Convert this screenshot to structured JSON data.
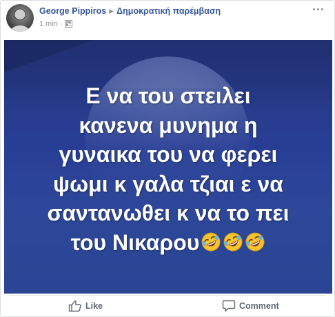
{
  "post": {
    "author": "George Pippiros",
    "group": "Δημοκρατική παρέμβαση",
    "time": "1 min",
    "caption_lines": [
      "Ε να του στειλει",
      "κανενα μυνημα η",
      "γυναικα του να φερει",
      "ψωμι κ γαλα τζιαι ε να",
      "σαντανωθει κ να το πει",
      "του Νικαρου"
    ],
    "caption_emoji": "rolling-on-floor-laughing x3"
  },
  "actions": {
    "like_label": "Like",
    "comment_label": "Comment"
  },
  "colors": {
    "link": "#365899",
    "meta": "#90949c",
    "action": "#606770",
    "image_bg": "#2a4091"
  }
}
